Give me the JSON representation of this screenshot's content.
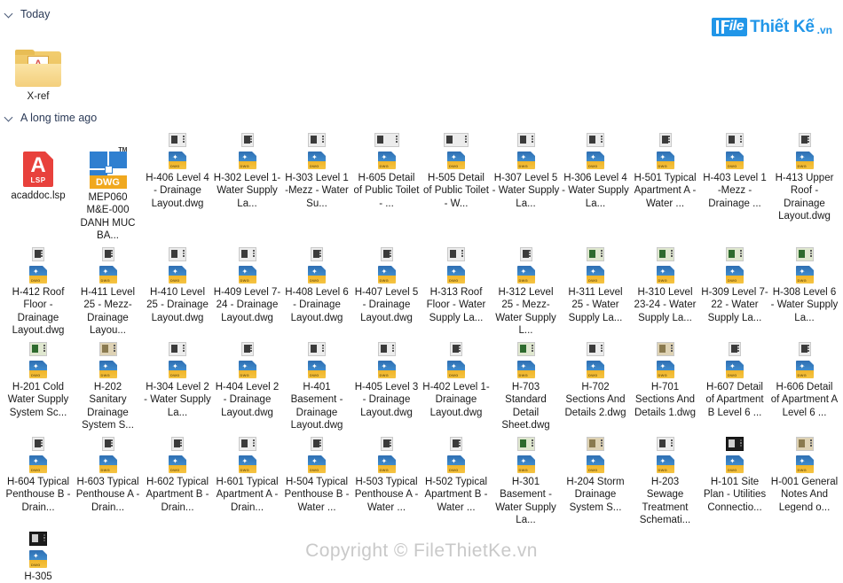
{
  "brand": {
    "mark": "File",
    "text": "Thiết Kế",
    "suffix": ".vn",
    "color": "#2196e8"
  },
  "watermark": "Copyright © FileThietKe.vn",
  "groups": [
    {
      "label": "Today"
    },
    {
      "label": "A long time ago"
    }
  ],
  "today_items": [
    {
      "name": "X-ref",
      "icon": "folder-xref-icon",
      "thumb": "none"
    }
  ],
  "items": [
    {
      "name": "acaddoc.lsp",
      "icon": "lsp-icon",
      "thumb": "none"
    },
    {
      "name": "MEP060 M&E-000 DANH MUC BA...",
      "icon": "dwg-big-icon",
      "thumb": "none"
    },
    {
      "name": "H-406 Level 4 - Drainage Layout.dwg",
      "icon": "dwg-icon",
      "thumb": "photo"
    },
    {
      "name": "H-302 Level 1-Water Supply La...",
      "icon": "dwg-icon",
      "thumb": "narrow"
    },
    {
      "name": "H-303 Level 1 -Mezz - Water Su...",
      "icon": "dwg-icon",
      "thumb": "photo"
    },
    {
      "name": "H-605 Detail of Public Toilet - ...",
      "icon": "dwg-icon",
      "thumb": "wide"
    },
    {
      "name": "H-505 Detail of Public Toilet - W...",
      "icon": "dwg-icon",
      "thumb": "wide"
    },
    {
      "name": "H-307 Level 5 - Water Supply La...",
      "icon": "dwg-icon",
      "thumb": "photo"
    },
    {
      "name": "H-306 Level 4 - Water Supply La...",
      "icon": "dwg-icon",
      "thumb": "photo"
    },
    {
      "name": "H-501 Typical Apartment A - Water ...",
      "icon": "dwg-icon",
      "thumb": "narrow"
    },
    {
      "name": "H-403 Level 1 -Mezz - Drainage ...",
      "icon": "dwg-icon",
      "thumb": "photo"
    },
    {
      "name": "H-413 Upper Roof - Drainage Layout.dwg",
      "icon": "dwg-icon",
      "thumb": "narrow"
    },
    {
      "name": "H-412 Roof Floor - Drainage Layout.dwg",
      "icon": "dwg-icon",
      "thumb": "narrow"
    },
    {
      "name": "H-411 Level 25 - Mezz-Drainage Layou...",
      "icon": "dwg-icon",
      "thumb": "narrow"
    },
    {
      "name": "H-410 Level 25 - Drainage Layout.dwg",
      "icon": "dwg-icon",
      "thumb": "photo"
    },
    {
      "name": "H-409 Level 7-24 - Drainage Layout.dwg",
      "icon": "dwg-icon",
      "thumb": "photo"
    },
    {
      "name": "H-408 Level 6 - Drainage Layout.dwg",
      "icon": "dwg-icon",
      "thumb": "narrow"
    },
    {
      "name": "H-407 Level 5 - Drainage Layout.dwg",
      "icon": "dwg-icon",
      "thumb": "narrow"
    },
    {
      "name": "H-313 Roof Floor - Water Supply La...",
      "icon": "dwg-icon",
      "thumb": "photo"
    },
    {
      "name": "H-312 Level 25 - Mezz-Water Supply L...",
      "icon": "dwg-icon",
      "thumb": "narrow"
    },
    {
      "name": "H-311 Level 25 - Water Supply La...",
      "icon": "dwg-icon",
      "thumb": "green"
    },
    {
      "name": "H-310 Level 23-24 - Water Supply La...",
      "icon": "dwg-icon",
      "thumb": "green"
    },
    {
      "name": "H-309 Level 7-22 - Water Supply La...",
      "icon": "dwg-icon",
      "thumb": "green"
    },
    {
      "name": "H-308 Level 6 - Water Supply La...",
      "icon": "dwg-icon",
      "thumb": "green"
    },
    {
      "name": "H-201 Cold Water Supply System Sc...",
      "icon": "dwg-icon",
      "thumb": "green"
    },
    {
      "name": "H-202 Sanitary Drainage System S...",
      "icon": "dwg-icon",
      "thumb": "tan"
    },
    {
      "name": "H-304 Level 2 - Water Supply La...",
      "icon": "dwg-icon",
      "thumb": "photo"
    },
    {
      "name": "H-404 Level 2 - Drainage Layout.dwg",
      "icon": "dwg-icon",
      "thumb": "narrow"
    },
    {
      "name": "H-401 Basement - Drainage Layout.dwg",
      "icon": "dwg-icon",
      "thumb": "photo"
    },
    {
      "name": "H-405 Level 3 - Drainage Layout.dwg",
      "icon": "dwg-icon",
      "thumb": "photo"
    },
    {
      "name": "H-402 Level 1-Drainage Layout.dwg",
      "icon": "dwg-icon",
      "thumb": "narrow"
    },
    {
      "name": "H-703 Standard Detail Sheet.dwg",
      "icon": "dwg-icon",
      "thumb": "green"
    },
    {
      "name": "H-702 Sections And Details 2.dwg",
      "icon": "dwg-icon",
      "thumb": "photo"
    },
    {
      "name": "H-701 Sections And Details 1.dwg",
      "icon": "dwg-icon",
      "thumb": "tan"
    },
    {
      "name": "H-607 Detail of Apartment B Level 6 ...",
      "icon": "dwg-icon",
      "thumb": "narrow"
    },
    {
      "name": "H-606 Detail of Apartment A Level 6 ...",
      "icon": "dwg-icon",
      "thumb": "narrow"
    },
    {
      "name": "H-604 Typical Penthouse B - Drain...",
      "icon": "dwg-icon",
      "thumb": "narrow"
    },
    {
      "name": "H-603 Typical Penthouse A - Drain...",
      "icon": "dwg-icon",
      "thumb": "narrow"
    },
    {
      "name": "H-602 Typical Apartment B - Drain...",
      "icon": "dwg-icon",
      "thumb": "narrow"
    },
    {
      "name": "H-601 Typical Apartment A - Drain...",
      "icon": "dwg-icon",
      "thumb": "photo"
    },
    {
      "name": "H-504 Typical Penthouse B - Water ...",
      "icon": "dwg-icon",
      "thumb": "narrow"
    },
    {
      "name": "H-503 Typical Penthouse A - Water ...",
      "icon": "dwg-icon",
      "thumb": "narrow"
    },
    {
      "name": "H-502 Typical Apartment B - Water ...",
      "icon": "dwg-icon",
      "thumb": "narrow"
    },
    {
      "name": "H-301 Basement - Water Supply La...",
      "icon": "dwg-icon",
      "thumb": "green"
    },
    {
      "name": "H-204 Storm Drainage System S...",
      "icon": "dwg-icon",
      "thumb": "tan"
    },
    {
      "name": "H-203 Sewage Treatment Schemati...",
      "icon": "dwg-icon",
      "thumb": "photo"
    },
    {
      "name": "H-101 Site Plan - Utilities Connectio...",
      "icon": "dwg-icon",
      "thumb": "dark"
    },
    {
      "name": "H-001 General Notes And Legend o...",
      "icon": "dwg-icon",
      "thumb": "tan"
    },
    {
      "name": "H-305",
      "icon": "dwg-icon",
      "thumb": "dark"
    }
  ]
}
